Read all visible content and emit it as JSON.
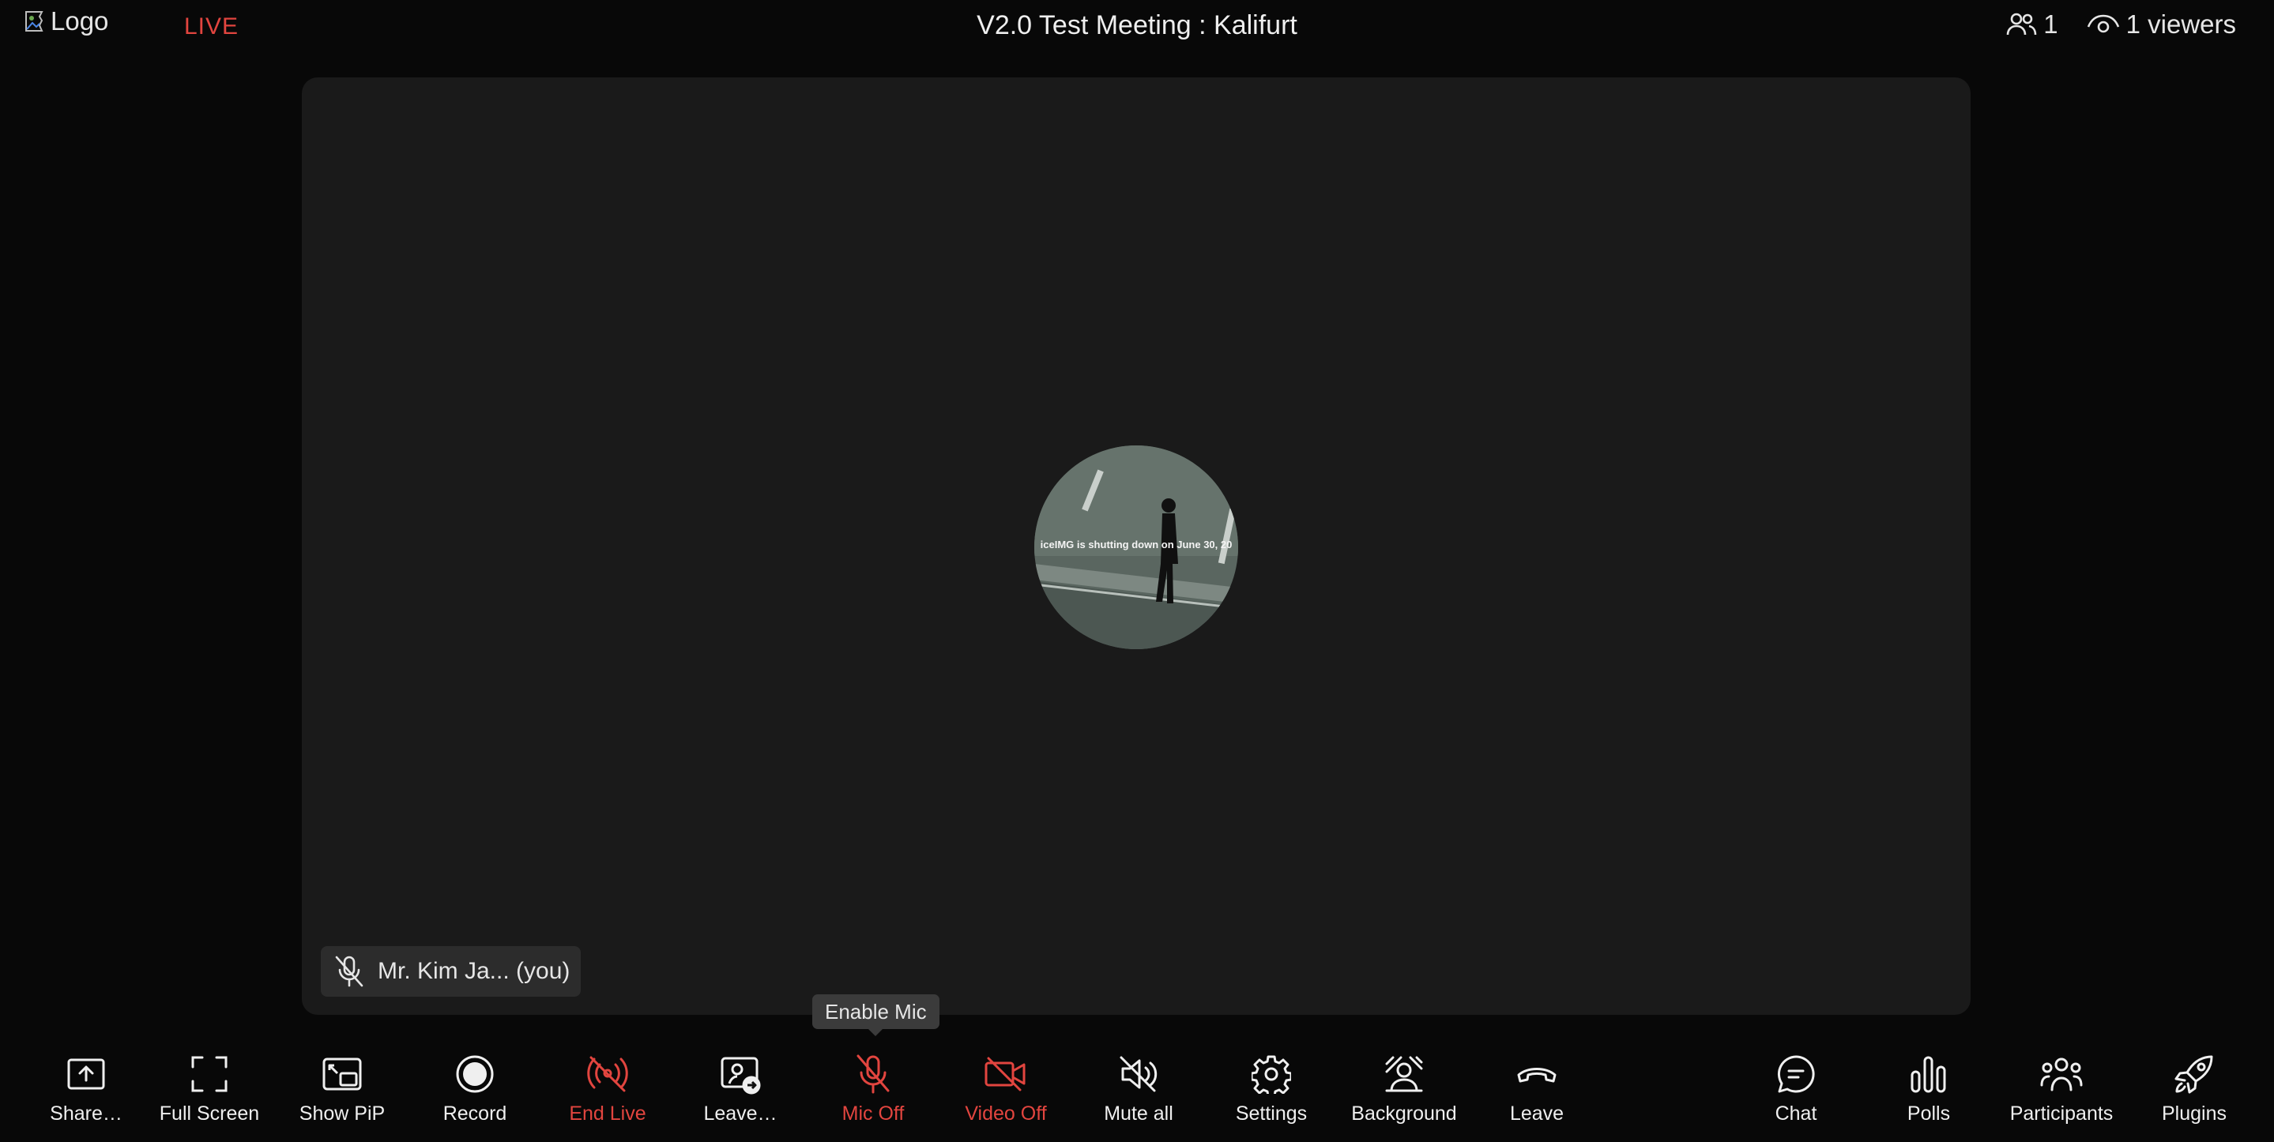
{
  "header": {
    "logo_alt": "Logo",
    "live_label": "LIVE",
    "meeting_title": "V2.0 Test Meeting : Kalifurt",
    "participant_count": "1",
    "viewers_label": "1 viewers"
  },
  "stage": {
    "avatar_overlay_text": "iceIMG is shutting down on June 30, 20",
    "name_tag": "Mr. Kim Ja... (you)"
  },
  "tooltip": {
    "text": "Enable Mic"
  },
  "toolbar": {
    "share": "Share…",
    "full_screen": "Full Screen",
    "show_pip": "Show PiP",
    "record": "Record",
    "end_live": "End Live",
    "leave_stage": "Leave…",
    "mic_off": "Mic Off",
    "video_off": "Video Off",
    "mute_all": "Mute all",
    "settings": "Settings",
    "background": "Background",
    "leave": "Leave",
    "chat": "Chat",
    "polls": "Polls",
    "participants": "Participants",
    "plugins": "Plugins"
  },
  "colors": {
    "page_bg": "#080808",
    "stage_bg": "#1a1a1a",
    "accent_red": "#e2453f",
    "text": "#efefef"
  }
}
